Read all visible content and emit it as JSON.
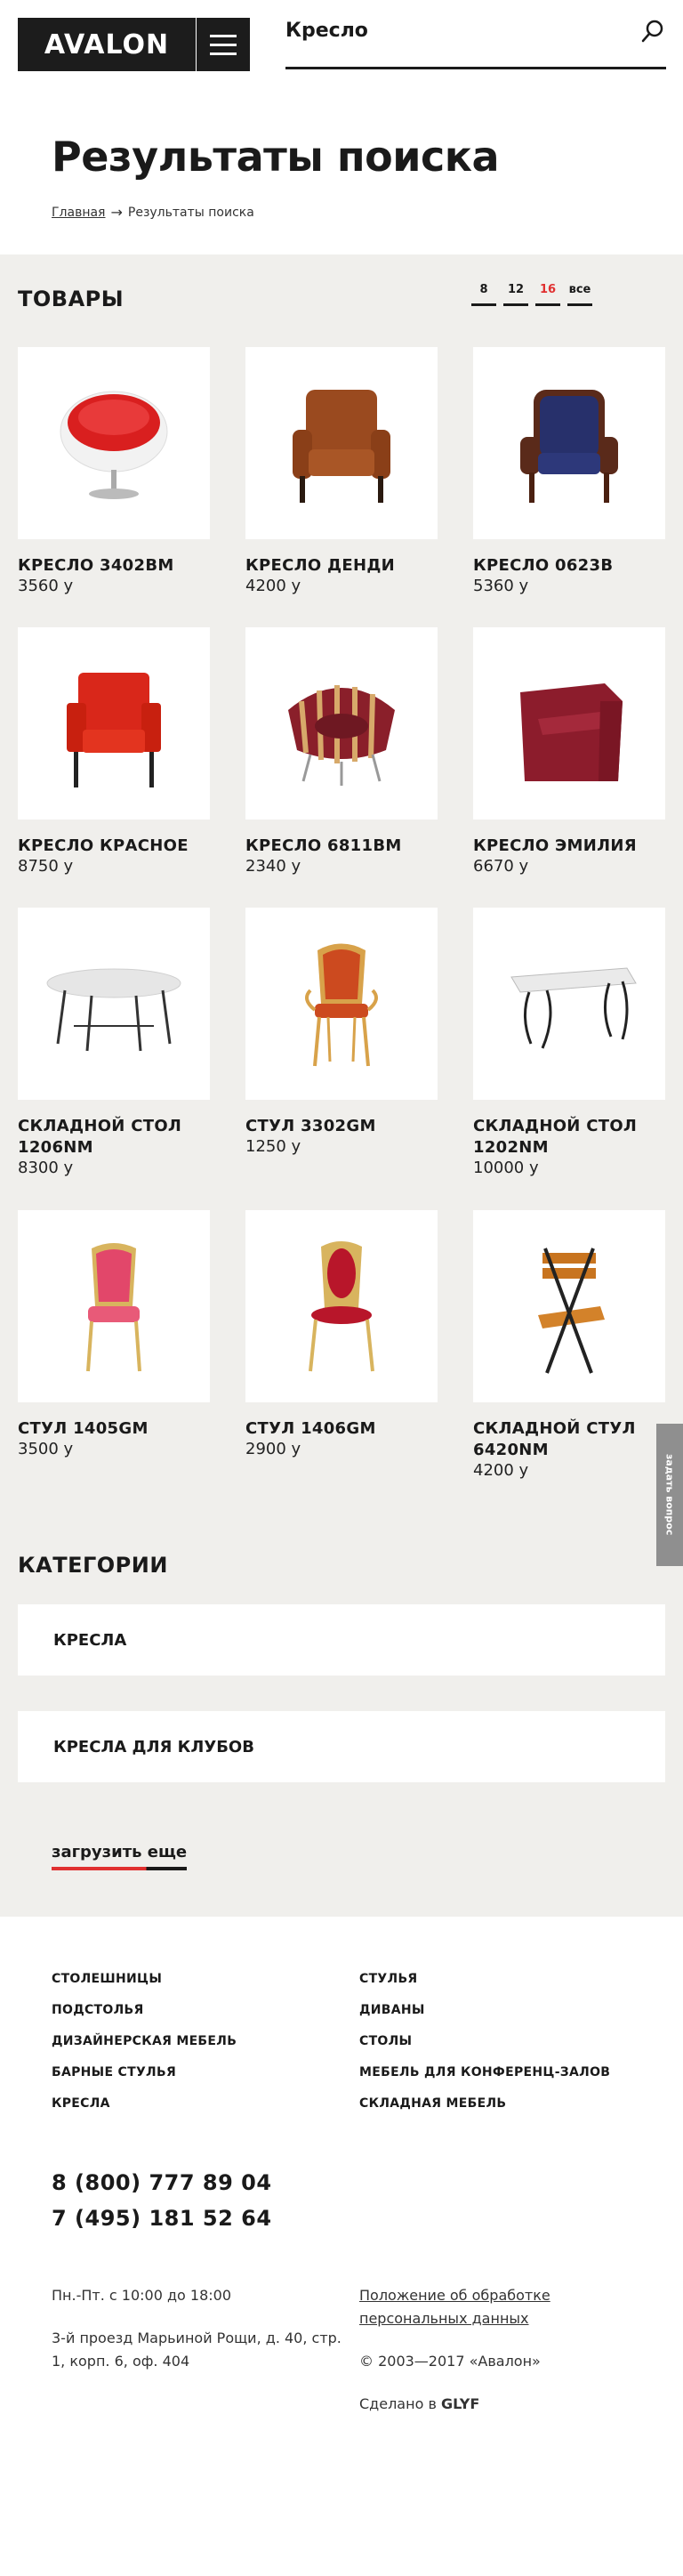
{
  "header": {
    "logo_text": "AVALON",
    "search_value": "Кресло"
  },
  "page": {
    "title": "Результаты поиска",
    "breadcrumb_home": "Главная",
    "breadcrumb_current": "Результаты поиска"
  },
  "products": {
    "section_title": "ТОВАРЫ",
    "per_page": [
      "8",
      "12",
      "16",
      "все"
    ],
    "per_page_active": "16",
    "items": [
      {
        "name": "КРЕСЛО 3402BM",
        "price": "3560 у",
        "icon": "egg-armchair-icon"
      },
      {
        "name": "КРЕСЛО ДЕНДИ",
        "price": "4200 у",
        "icon": "leather-armchair-icon"
      },
      {
        "name": "КРЕСЛО 0623B",
        "price": "5360 у",
        "icon": "blue-armchair-icon"
      },
      {
        "name": "КРЕСЛО КРАСНОЕ",
        "price": "8750 у",
        "icon": "red-armchair-icon"
      },
      {
        "name": "КРЕСЛО 6811BM",
        "price": "2340 у",
        "icon": "striped-armchair-icon"
      },
      {
        "name": "КРЕСЛО ЭМИЛИЯ",
        "price": "6670 у",
        "icon": "cube-armchair-icon"
      },
      {
        "name": "СКЛАДНОЙ СТОЛ 1206NM",
        "price": "8300 у",
        "icon": "round-table-icon"
      },
      {
        "name": "СТУЛ 3302GM",
        "price": "1250 у",
        "icon": "banquet-armchair-icon"
      },
      {
        "name": "СКЛАДНОЙ СТОЛ 1202NM",
        "price": "10000 у",
        "icon": "rect-table-icon"
      },
      {
        "name": "СТУЛ 1405GM",
        "price": "3500 у",
        "icon": "pink-chair-icon"
      },
      {
        "name": "СТУЛ 1406GM",
        "price": "2900 у",
        "icon": "red-banquet-chair-icon"
      },
      {
        "name": "СКЛАДНОЙ СТУЛ 6420NM",
        "price": "4200 у",
        "icon": "folding-chair-icon"
      }
    ]
  },
  "categories": {
    "title": "КАТЕГОРИИ",
    "items": [
      "КРЕСЛА",
      "КРЕСЛА ДЛЯ КЛУБОВ"
    ]
  },
  "load_more": "загрузить еще",
  "ask_tab": "задать вопрос",
  "footer": {
    "links": [
      "СТОЛЕШНИЦЫ",
      "СТУЛЬЯ",
      "ПОДСТОЛЬЯ",
      "ДИВАНЫ",
      "ДИЗАЙНЕРСКАЯ МЕБЕЛЬ",
      "СТОЛЫ",
      "БАРНЫЕ СТУЛЬЯ",
      "МЕБЕЛЬ ДЛЯ КОНФЕРЕНЦ-ЗАЛОВ",
      "КРЕСЛА",
      "СКЛАДНАЯ МЕБЕЛЬ"
    ],
    "phones": [
      "8 (800) 777 89 04",
      "7 (495) 181 52 64"
    ],
    "hours": "Пн.-Пт. с 10:00 до 18:00",
    "address": "3-й проезд Марьиной Рощи, д. 40, стр. 1, корп. 6, оф. 404",
    "policy": "Положение об обработке персональных данных",
    "copyright": "© 2003—2017 «Авалон»",
    "made_by_prefix": "Сделано в",
    "made_by_brand": "GLYF"
  },
  "colors": {
    "accent": "#e03030",
    "dark": "#1c1c1c",
    "content_bg": "#f0efec"
  }
}
